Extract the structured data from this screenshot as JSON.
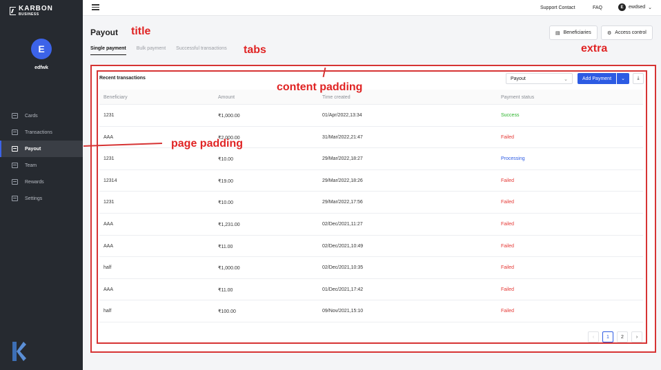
{
  "brand": {
    "name": "KARBON",
    "sub": "BUSINESS"
  },
  "user": {
    "initial": "E",
    "name": "edfwk"
  },
  "sidebar": {
    "items": [
      {
        "label": "Cards",
        "icon": "card-icon"
      },
      {
        "label": "Transactions",
        "icon": "list-icon"
      },
      {
        "label": "Payout",
        "icon": "payout-icon",
        "active": true
      },
      {
        "label": "Team",
        "icon": "team-icon"
      },
      {
        "label": "Rewards",
        "icon": "gift-icon"
      },
      {
        "label": "Settings",
        "icon": "settings-icon"
      }
    ]
  },
  "topbar": {
    "support": "Support Contact",
    "faq": "FAQ",
    "user_initial": "E",
    "user_name": "ewdsed"
  },
  "header": {
    "title": "Payout",
    "tabs": [
      "Single payment",
      "Bulk payment",
      "Successful transactions"
    ],
    "beneficiaries": "Beneficiaries",
    "access": "Access control"
  },
  "annotations": {
    "title": "title",
    "tabs": "tabs",
    "extra": "extra",
    "content_padding": "content padding",
    "page_padding": "page padding"
  },
  "card": {
    "title": "Recent transactions",
    "select_value": "Payout",
    "add_payment": "Add Payment",
    "columns": [
      "Beneficiary",
      "Amount",
      "Time created",
      "Payment status"
    ],
    "rows": [
      [
        "1231",
        "₹1,000.00",
        "01/Apr/2022,13:34",
        "Success"
      ],
      [
        "AAA",
        "₹2,000.00",
        "31/Mar/2022,21:47",
        "Failed"
      ],
      [
        "1231",
        "₹10.00",
        "29/Mar/2022,18:27",
        "Processing"
      ],
      [
        "12314",
        "₹19.00",
        "29/Mar/2022,18:26",
        "Failed"
      ],
      [
        "1231",
        "₹10.00",
        "29/Mar/2022,17:56",
        "Failed"
      ],
      [
        "AAA",
        "₹1,231.00",
        "02/Dec/2021,11:27",
        "Failed"
      ],
      [
        "AAA",
        "₹11.00",
        "02/Dec/2021,10:49",
        "Failed"
      ],
      [
        "half",
        "₹1,000.00",
        "02/Dec/2021,10:35",
        "Failed"
      ],
      [
        "AAA",
        "₹11.00",
        "01/Dec/2021,17:42",
        "Failed"
      ],
      [
        "half",
        "₹100.00",
        "09/Nov/2021,15:10",
        "Failed"
      ]
    ],
    "pages": [
      "1",
      "2"
    ],
    "current_page": "1"
  },
  "colors": {
    "accent": "#2d5be3",
    "success": "#2bb32b",
    "failed": "#e53935",
    "annotation": "#e02424"
  }
}
